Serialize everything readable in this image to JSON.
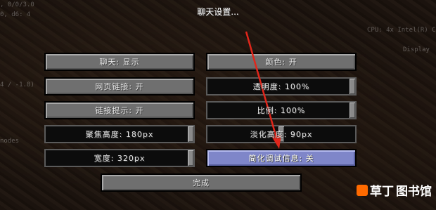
{
  "title": "聊天设置...",
  "debug": {
    "line1": ", 0/0/3.0",
    "line2": "0, d6: 4",
    "line3": "4 / -1.8)",
    "line4": "nodes",
    "cpu": "CPU: 4x Intel(R) Co",
    "display": "Display"
  },
  "left": {
    "chat": "聊天: 显示",
    "web_links": "网页链接: 开",
    "link_prompt": "链接提示: 开",
    "focused_height": "聚焦高度: 180px",
    "width": "宽度: 320px"
  },
  "right": {
    "colors": "颜色: 开",
    "opacity": "透明度: 100%",
    "scale": "比例: 100%",
    "fade": "淡化高度: 90px",
    "reduced_debug": "简化调试信息: 关"
  },
  "sliders": {
    "opacity": 1.0,
    "scale": 1.0,
    "focused_height": 1.0,
    "fade": 0.5,
    "width": 1.0
  },
  "done": "完成",
  "watermark": {
    "a": "草丁",
    "b": "图书馆"
  },
  "colors": {
    "highlight": "#7f86c9",
    "arrow": "#e0261b"
  }
}
